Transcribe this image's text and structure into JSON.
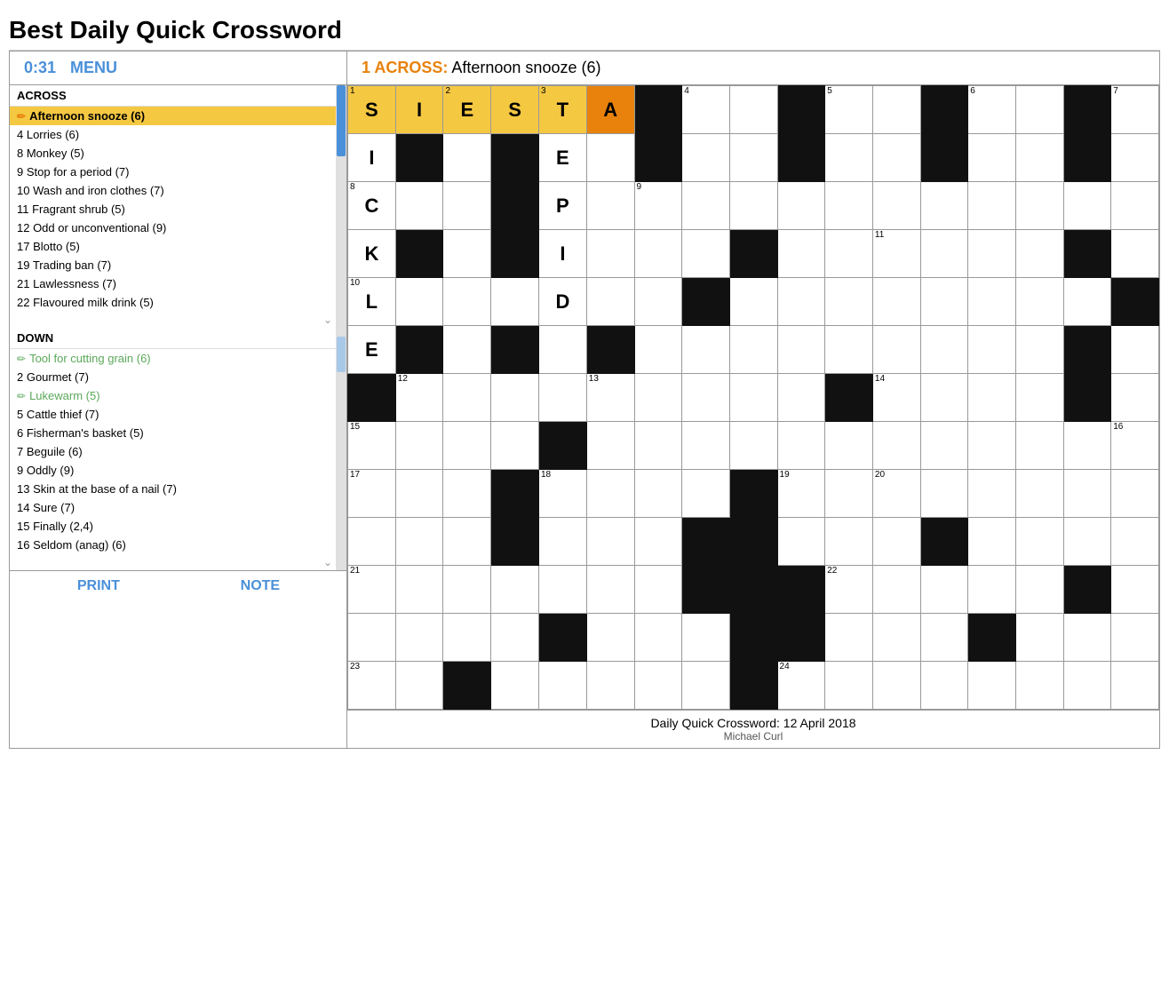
{
  "page": {
    "title": "Best Daily Quick Crossword"
  },
  "header": {
    "timer": "0:31",
    "menu_label": "MENU",
    "active_clue_label": "1 ACROSS:",
    "active_clue_text": " Afternoon snooze (6)"
  },
  "across_clues": [
    {
      "number": "1",
      "text": "Afternoon snooze (6)",
      "active": true,
      "pencil": true
    },
    {
      "number": "4",
      "text": "Lorries (6)"
    },
    {
      "number": "8",
      "text": "Monkey (5)"
    },
    {
      "number": "9",
      "text": "Stop for a period (7)"
    },
    {
      "number": "10",
      "text": "Wash and iron clothes (7)"
    },
    {
      "number": "11",
      "text": "Fragrant shrub (5)"
    },
    {
      "number": "12",
      "text": "Odd or unconventional (9)"
    },
    {
      "number": "17",
      "text": "Blotto (5)"
    },
    {
      "number": "19",
      "text": "Trading ban (7)"
    },
    {
      "number": "21",
      "text": "Lawlessness (7)"
    },
    {
      "number": "22",
      "text": "Flavoured milk drink (5)"
    }
  ],
  "down_clues": [
    {
      "number": "1",
      "text": "Tool for cutting grain (6)",
      "pencil": true
    },
    {
      "number": "2",
      "text": "Gourmet (7)"
    },
    {
      "number": "3",
      "text": "Lukewarm (5)",
      "pencil": true,
      "active": true
    },
    {
      "number": "5",
      "text": "Cattle thief (7)"
    },
    {
      "number": "6",
      "text": "Fisherman's basket (5)"
    },
    {
      "number": "7",
      "text": "Beguile (6)"
    },
    {
      "number": "9",
      "text": "Oddly (9)"
    },
    {
      "number": "13",
      "text": "Skin at the base of a nail (7)"
    },
    {
      "number": "14",
      "text": "Sure (7)"
    },
    {
      "number": "15",
      "text": "Finally (2,4)"
    },
    {
      "number": "16",
      "text": "Seldom (anag) (6)"
    }
  ],
  "grid_footer": {
    "text": "Daily Quick Crossword: 12 April 2018",
    "attribution": "Michael Curl"
  },
  "footer": {
    "print_label": "PRINT",
    "note_label": "NOTE"
  }
}
